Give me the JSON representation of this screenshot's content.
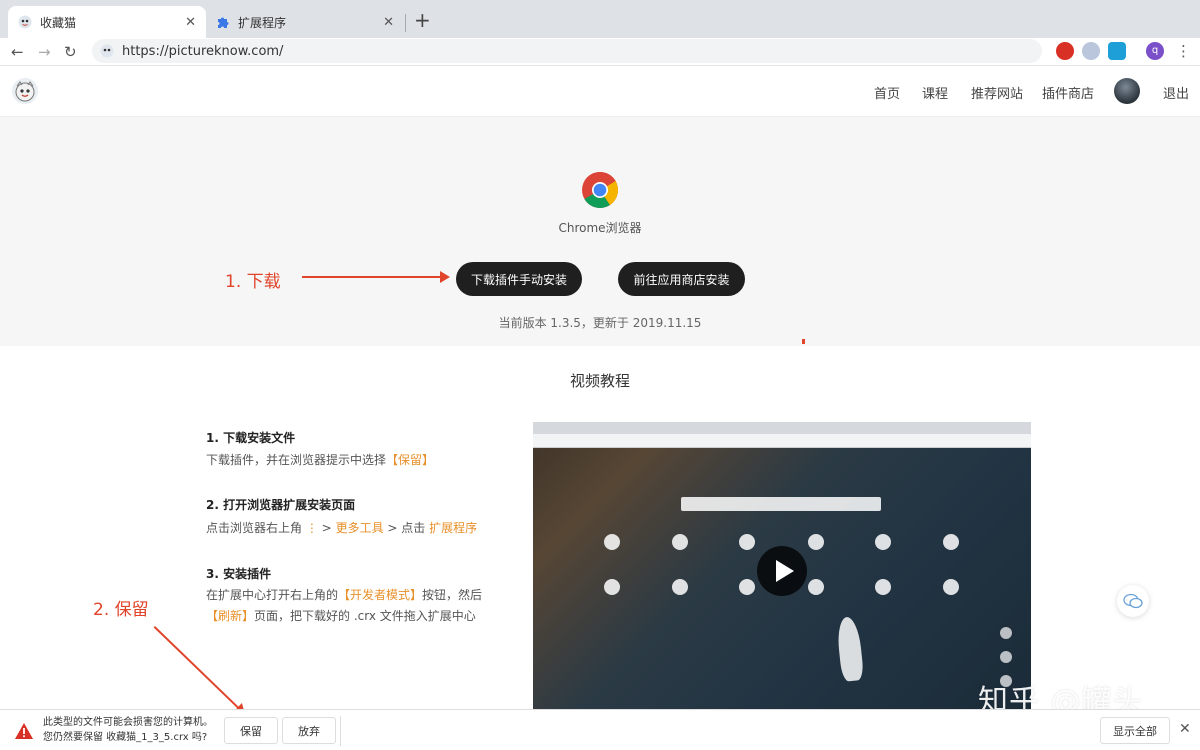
{
  "browser": {
    "tabs": [
      {
        "title": "收藏猫",
        "close": "✕"
      },
      {
        "title": "扩展程序",
        "close": "✕"
      }
    ],
    "new_tab": "+",
    "url": "https://pictureknow.com/",
    "back": "←",
    "forward": "→",
    "reload": "↻",
    "profile_initial": "q",
    "menu": "⋮"
  },
  "header": {
    "nav": [
      "首页",
      "课程",
      "推荐网站",
      "插件商店"
    ],
    "logout": "退出"
  },
  "hero": {
    "browser_label": "Chrome浏览器",
    "annotation_1": "1. 下载",
    "download_button": "下载插件手动安装",
    "store_button": "前往应用商店安装",
    "version_text": "当前版本 1.3.5，更新于 2019.11.15"
  },
  "tutorial": {
    "title": "视频教程",
    "step1": {
      "title": "1. 下载安装文件",
      "text_a": "下载插件，并在浏览器提示中选择",
      "text_hl": "【保留】"
    },
    "step2": {
      "title": "2. 打开浏览器扩展安装页面",
      "text_a": "点击浏览器右上角",
      "dots": "⋮",
      "sep1": ">",
      "hl1": "更多工具",
      "text_b": "> 点击",
      "hl2": "扩展程序"
    },
    "step3": {
      "title": "3. 安装插件",
      "text_a": "在扩展中心打开右上角的",
      "hl1": "【开发者模式】",
      "text_b": "按钮，然后",
      "hl2": "【刷新】",
      "text_c": "页面，把下载好的 .crx 文件拖入扩展中心"
    },
    "annotation_2": "2. 保留"
  },
  "watermark": "知乎 @罐头",
  "download_bar": {
    "line1": "此类型的文件可能会损害您的计算机。",
    "line2": "您仍然要保留 收藏猫_1_3_5.crx 吗?",
    "keep": "保留",
    "discard": "放弃",
    "show_all": "显示全部",
    "close": "✕"
  },
  "colors": {
    "accent": "#e0442a",
    "highlight": "#e8902b",
    "button_dark": "#1f1f1f"
  },
  "icons": {
    "tab1": "cat-logo-icon",
    "tab2": "puzzle-icon",
    "warning": "warning-icon",
    "chat": "chat-icon",
    "chrome": "chrome-logo-icon"
  }
}
